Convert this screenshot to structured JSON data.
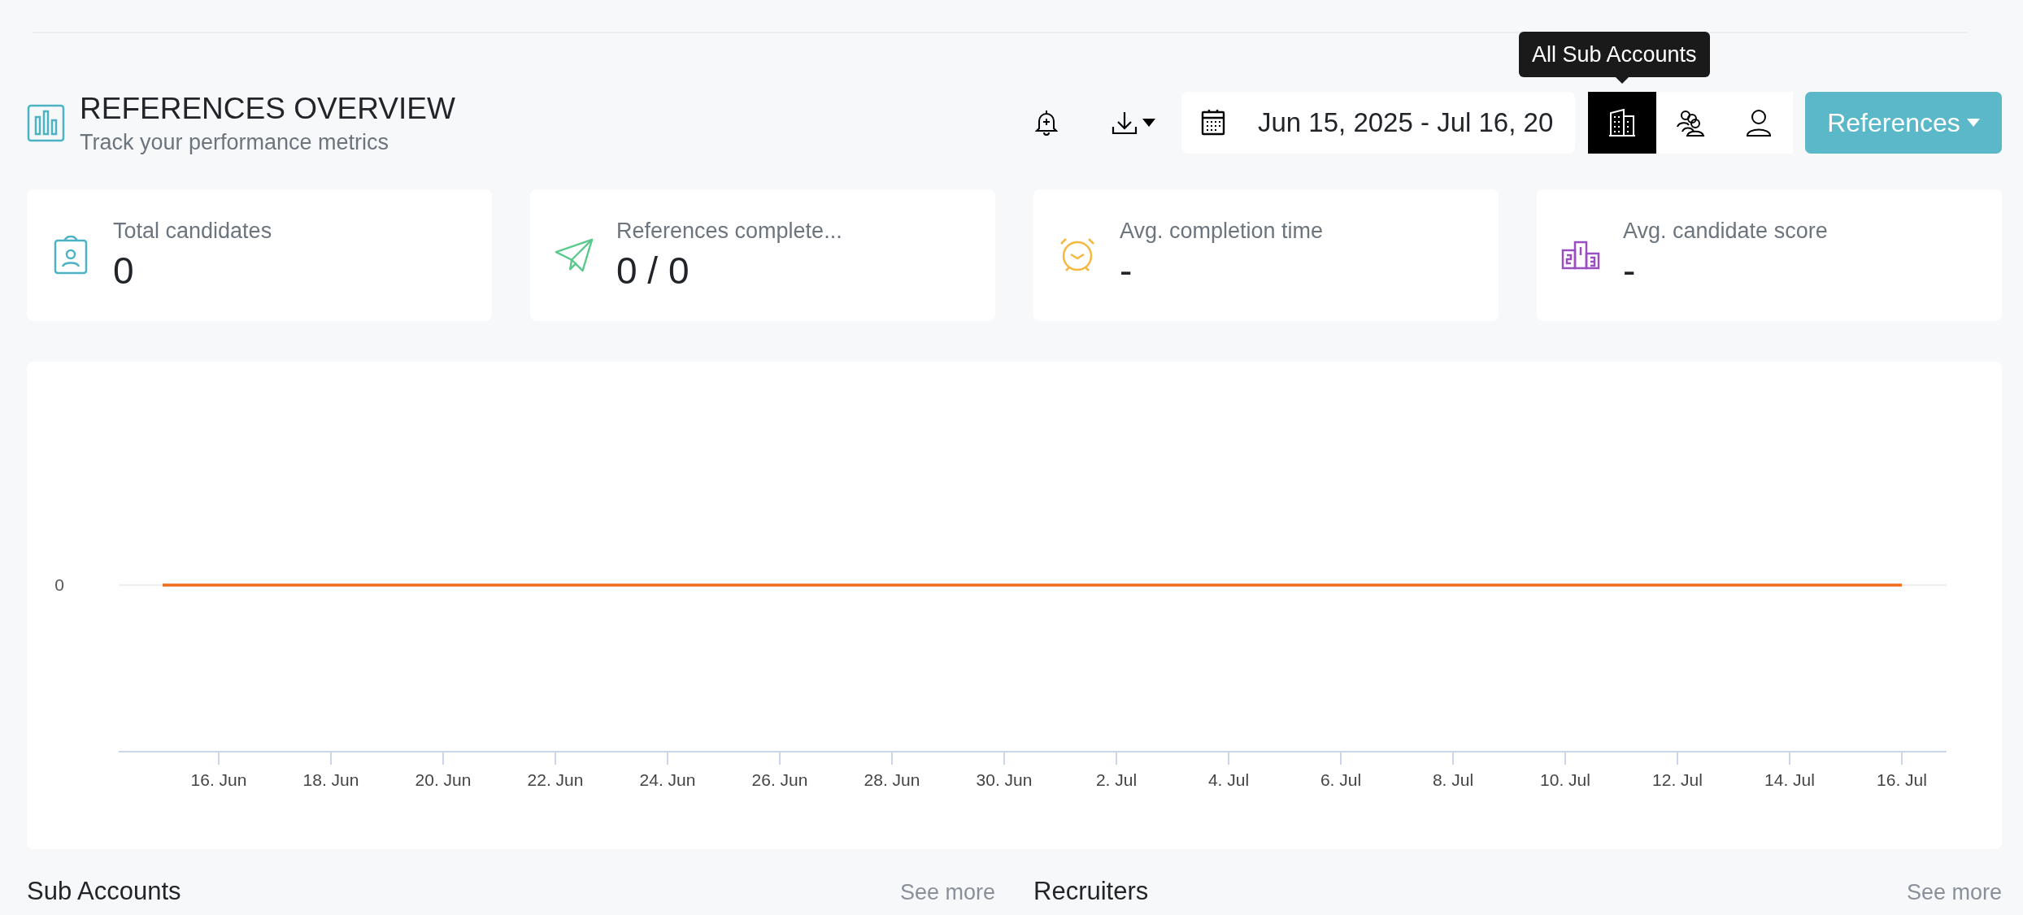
{
  "header": {
    "title": "REFERENCES OVERVIEW",
    "subtitle": "Track your performance metrics"
  },
  "toolbar": {
    "date_range": "Jun 15, 2025 - Jul 16, 20",
    "view_toggles": [
      {
        "selected": true
      },
      {
        "selected": false
      },
      {
        "selected": false
      }
    ],
    "tooltip": "All Sub Accounts",
    "dropdown": "References"
  },
  "stats": [
    {
      "label": "Total candidates",
      "value": "0"
    },
    {
      "label": "References complete...",
      "value": "0 / 0"
    },
    {
      "label": "Avg. completion time",
      "value": "-"
    },
    {
      "label": "Avg. candidate score",
      "value": "-"
    }
  ],
  "chart": {
    "y_axis_labels": [
      "0"
    ],
    "x_axis_labels": [
      "16. Jun",
      "18. Jun",
      "20. Jun",
      "22. Jun",
      "24. Jun",
      "26. Jun",
      "28. Jun",
      "30. Jun",
      "2. Jul",
      "4. Jul",
      "6. Jul",
      "8. Jul",
      "10. Jul",
      "12. Jul",
      "14. Jul",
      "16. Jul"
    ]
  },
  "sections": [
    {
      "title": "Sub Accounts",
      "link": "See more"
    },
    {
      "title": "Recruiters",
      "link": "See more"
    }
  ]
}
